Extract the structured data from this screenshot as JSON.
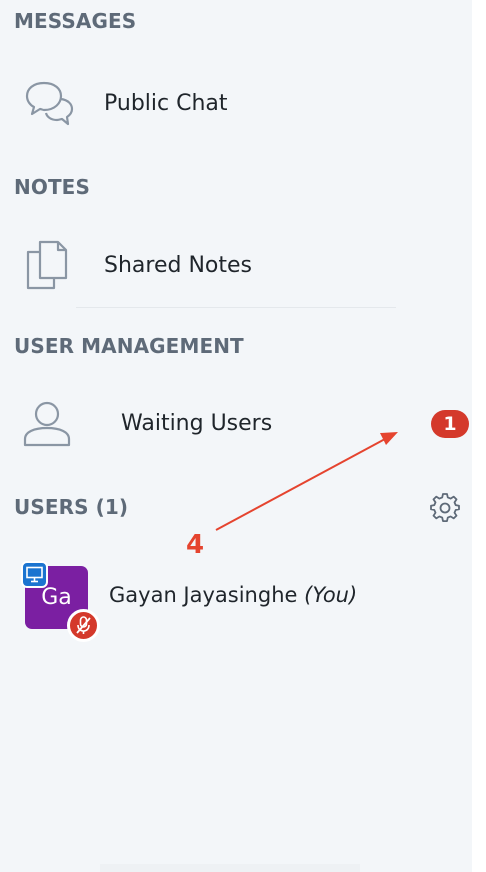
{
  "messages": {
    "title": "MESSAGES",
    "items": [
      {
        "label": "Public Chat",
        "icon": "chat-bubbles-icon"
      }
    ]
  },
  "notes": {
    "title": "NOTES",
    "items": [
      {
        "label": "Shared Notes",
        "icon": "document-copy-icon"
      }
    ]
  },
  "user_management": {
    "title": "USER MANAGEMENT",
    "items": [
      {
        "label": "Waiting Users",
        "icon": "person-outline-icon",
        "badge": "1"
      }
    ]
  },
  "users": {
    "title": "USERS (1)",
    "settings_icon": "gear-icon",
    "list": [
      {
        "initials": "Ga",
        "name": "Gayan Jayasinghe",
        "suffix": "(You)",
        "avatar_color": "#7b1fa2",
        "presenter": true,
        "muted": true
      }
    ]
  },
  "annotation": {
    "step": "4",
    "color": "#e5442f"
  },
  "colors": {
    "panel_bg": "#f3f6f9",
    "section_title": "#5e6a78",
    "badge": "#d4392b",
    "presenter_blue": "#1b74d0"
  }
}
